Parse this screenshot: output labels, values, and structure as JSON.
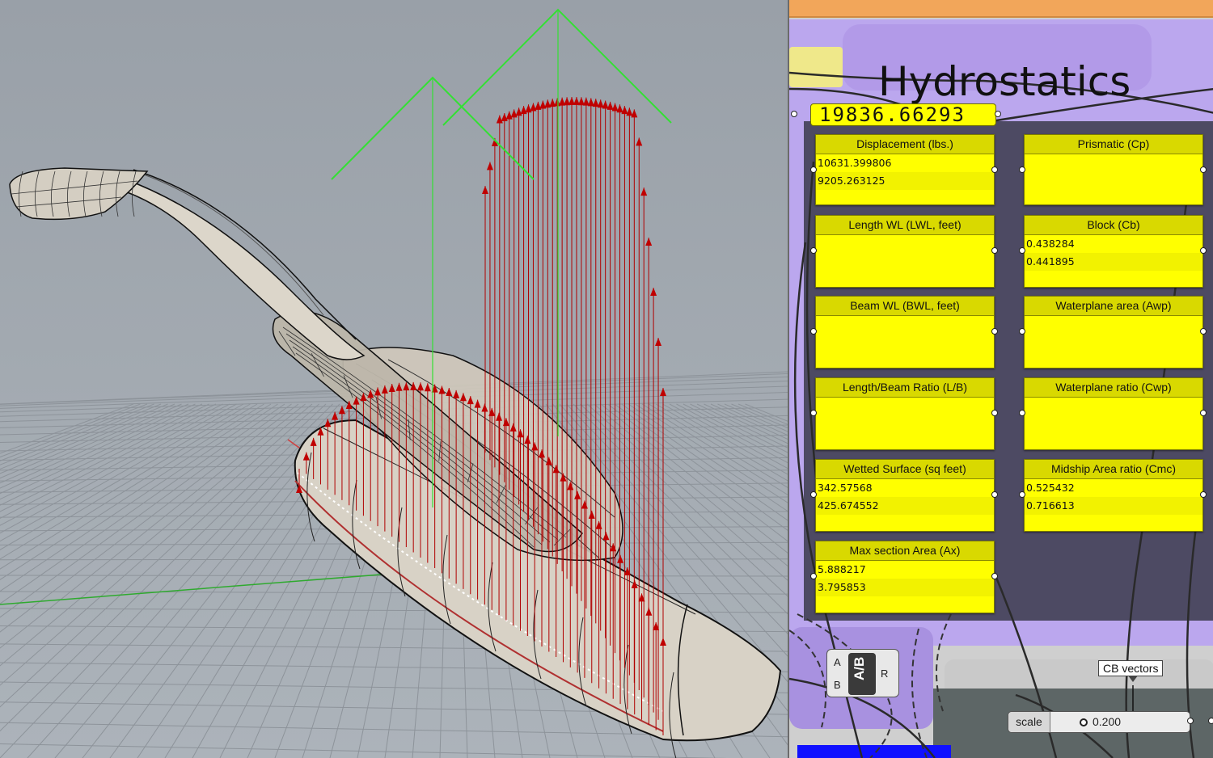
{
  "viewport": {
    "label": "Rhino perspective viewport with hull model",
    "icons": [
      "hull-surface",
      "ground-grid",
      "buoyancy-vectors"
    ],
    "colors": {
      "background": "#a0a7ae",
      "grid": "#8c9299",
      "vectors": "#b00000",
      "axis_green": "#2fd22f",
      "hull": "#d8d2c6"
    }
  },
  "gh": {
    "group_title": "Hydrostatics",
    "main_value": "19836.66293",
    "panels": [
      {
        "id": "displacement",
        "title": "Displacement (lbs.)",
        "lines": [
          "10631.399806",
          "9205.263125"
        ]
      },
      {
        "id": "prismatic",
        "title": "Prismatic (Cp)",
        "lines": []
      },
      {
        "id": "length-wl",
        "title": "Length WL (LWL, feet)",
        "lines": []
      },
      {
        "id": "block",
        "title": "Block (Cb)",
        "lines": [
          "0.438284",
          "0.441895"
        ]
      },
      {
        "id": "beam-wl",
        "title": "Beam WL (BWL, feet)",
        "lines": []
      },
      {
        "id": "waterplane-area",
        "title": "Waterplane area (Awp)",
        "lines": []
      },
      {
        "id": "length-beam",
        "title": "Length/Beam Ratio (L/B)",
        "lines": []
      },
      {
        "id": "waterplane-ratio",
        "title": "Waterplane ratio (Cwp)",
        "lines": []
      },
      {
        "id": "wetted-surface",
        "title": "Wetted Surface (sq feet)",
        "lines": [
          "342.57568",
          "425.674552"
        ]
      },
      {
        "id": "midship-area",
        "title": "Midship Area ratio (Cmc)",
        "lines": [
          "0.525432",
          "0.716613"
        ]
      },
      {
        "id": "max-section",
        "title": "Max section Area (Ax)",
        "lines": [
          "5.888217",
          "3.795853"
        ]
      }
    ],
    "ab_component": {
      "in_a": "A",
      "in_b": "B",
      "core": "A/B",
      "out": "R"
    },
    "cb_vectors_label": "CB vectors",
    "slider": {
      "label": "scale",
      "value": "0.200",
      "fraction": 0.2
    },
    "colors": {
      "panel": "#ffff00",
      "panel_header": "#d9d900",
      "group_purple": "#bba7ee",
      "group_dark": "#4d4a63",
      "group_orange": "#f2a65a",
      "slate": "#5d6666"
    }
  }
}
